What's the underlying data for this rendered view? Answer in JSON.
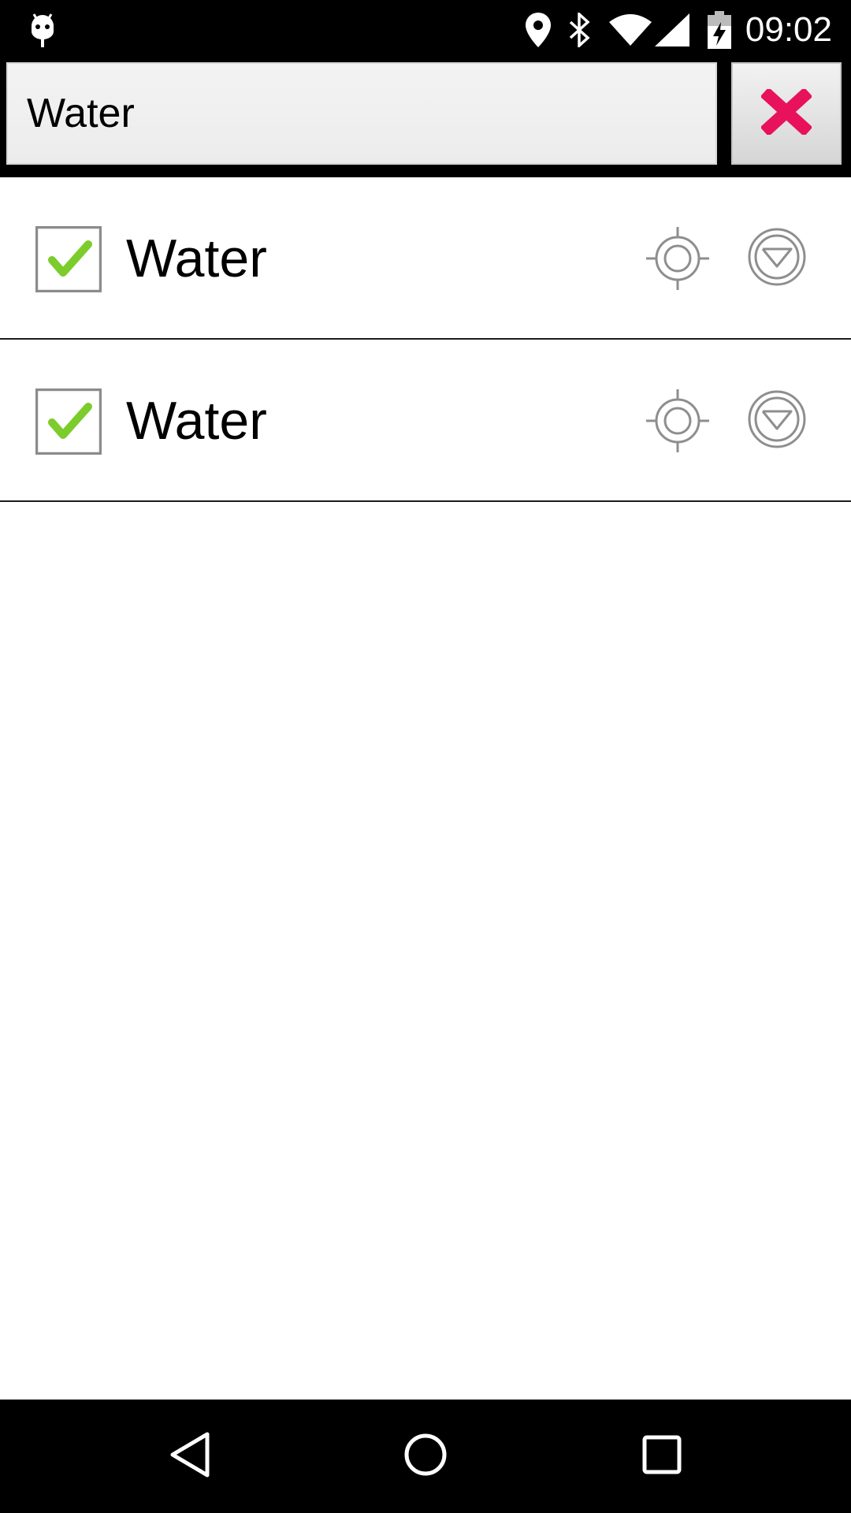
{
  "status_bar": {
    "time": "09:02",
    "icons": [
      "android-debug-icon",
      "location-pin-icon",
      "bluetooth-icon",
      "wifi-icon",
      "cell-signal-icon",
      "battery-charging-icon"
    ]
  },
  "search": {
    "value": "Water",
    "clear_icon": "close-x-icon",
    "clear_color": "#e8125c"
  },
  "items": [
    {
      "label": "Water",
      "checked": true
    },
    {
      "label": "Water",
      "checked": true
    }
  ],
  "item_icons": [
    "checkmark-icon",
    "crosshair-icon",
    "dropdown-circle-icon"
  ],
  "nav_bar": {
    "icons": [
      "back-icon",
      "home-icon",
      "recents-icon"
    ]
  },
  "colors": {
    "check_green": "#7ccc2c",
    "icon_gray": "#8e8e8e",
    "divider": "#1b1b1b"
  }
}
